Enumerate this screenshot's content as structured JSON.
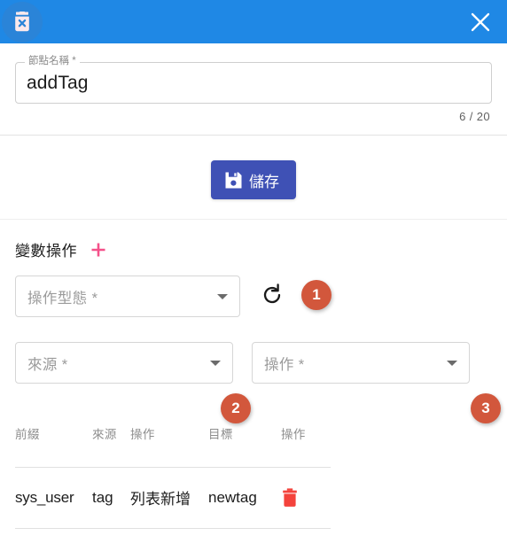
{
  "header": {
    "icon": "trash-x-icon",
    "close_label": "×",
    "accent_color": "#1f88e5",
    "avatar_color": "#2a84d8"
  },
  "name_field": {
    "label": "節點名稱 *",
    "value": "addTag",
    "placeholder": "節點名稱",
    "counter": "6 / 20"
  },
  "save": {
    "label": "儲存",
    "icon": "save-floppy-icon",
    "color": "#3f51b5"
  },
  "var_ops": {
    "title": "變數操作",
    "add_icon": "plus-icon",
    "add_color": "#f4518a",
    "op_type": {
      "placeholder": "操作型態 *"
    },
    "refresh_icon": "refresh-icon",
    "source": {
      "placeholder": "來源 *"
    },
    "operation": {
      "placeholder": "操作 *"
    },
    "badges": [
      {
        "label": "1"
      },
      {
        "label": "2"
      },
      {
        "label": "3"
      }
    ],
    "badge_color": "#d2573c"
  },
  "table": {
    "columns": [
      "前綴",
      "來源",
      "操作",
      "目標",
      "操作"
    ],
    "rows": [
      {
        "prefix": "sys_user",
        "source": "tag",
        "action": "列表新增",
        "target": "newtag",
        "delete_icon": "trash-icon",
        "delete_color": "#f4433c"
      }
    ]
  }
}
